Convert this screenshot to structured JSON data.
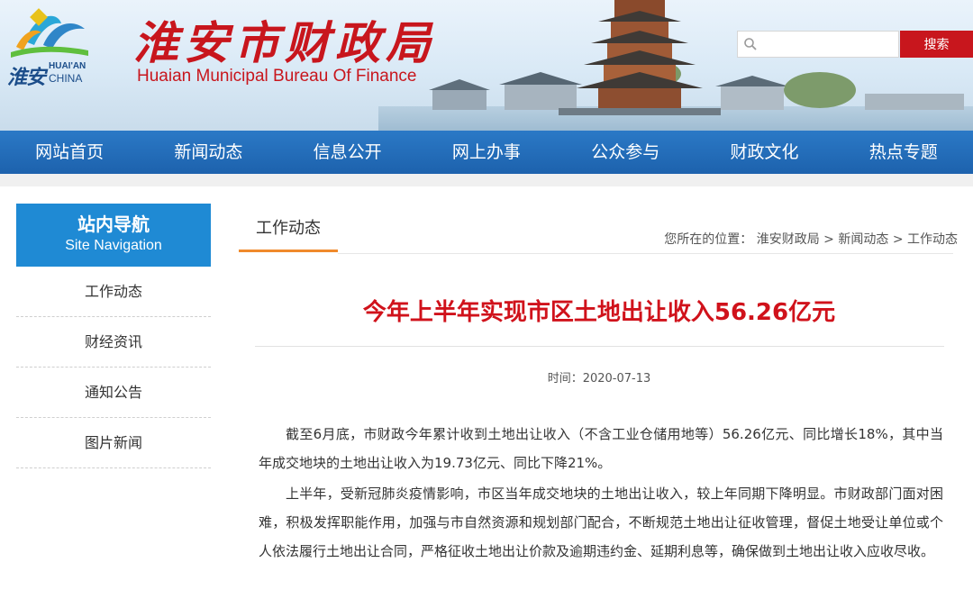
{
  "header": {
    "site_title_cn": "淮安市财政局",
    "site_title_en": "Huaian Municipal Bureau Of Finance",
    "logo_city_cn": "淮安",
    "logo_city_en1": "HUAI'AN",
    "logo_city_en2": "CHINA",
    "search_placeholder": "",
    "search_button": "搜索"
  },
  "nav": {
    "items": [
      "网站首页",
      "新闻动态",
      "信息公开",
      "网上办事",
      "公众参与",
      "财政文化",
      "热点专题"
    ]
  },
  "sidebar": {
    "title_cn": "站内导航",
    "title_en": "Site Navigation",
    "items": [
      "工作动态",
      "财经资讯",
      "通知公告",
      "图片新闻"
    ]
  },
  "main": {
    "tab_title": "工作动态",
    "breadcrumb": {
      "prefix": "您所在的位置：",
      "items": [
        "淮安财政局",
        "新闻动态",
        "工作动态"
      ],
      "separator": ">"
    },
    "article_title": "今年上半年实现市区土地出让收入56.26亿元",
    "meta": "时间：2020-07-13",
    "paragraphs": [
      "截至6月底，市财政今年累计收到土地出让收入（不含工业仓储用地等）56.26亿元、同比增长18%，其中当年成交地块的土地出让收入为19.73亿元、同比下降21%。",
      "上半年，受新冠肺炎疫情影响，市区当年成交地块的土地出让收入，较上年同期下降明显。市财政部门面对困难，积极发挥职能作用，加强与市自然资源和规划部门配合，不断规范土地出让征收管理，督促土地受让单位或个人依法履行土地出让合同，严格征收土地出让价款及逾期违约金、延期利息等，确保做到土地出让收入应收尽收。"
    ]
  },
  "colors": {
    "brand_red": "#c8161d",
    "nav_blue": "#1d62ad",
    "sidebar_blue": "#1f8ad4",
    "tab_orange": "#f08a2c",
    "title_red": "#d0121b"
  },
  "icons": {
    "logo": "huaian-city-logo-icon",
    "search": "search-icon",
    "pagoda": "pagoda-illustration"
  }
}
